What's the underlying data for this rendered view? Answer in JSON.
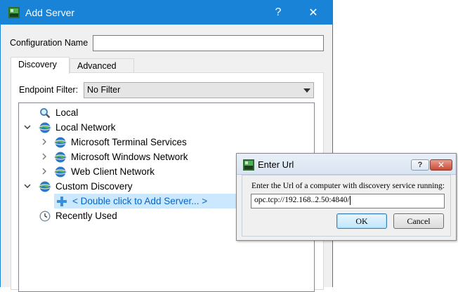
{
  "main_window": {
    "title": "Add Server",
    "help_label": "?",
    "close_label": "✕",
    "config_name_label": "Configuration Name",
    "config_name_value": "",
    "tabs": [
      {
        "label": "Discovery",
        "active": true
      },
      {
        "label": "Advanced",
        "active": false
      }
    ],
    "endpoint_filter_label": "Endpoint Filter:",
    "endpoint_filter_value": "No Filter",
    "tree": [
      {
        "label": "Local",
        "icon": "magnifier-icon",
        "expander": "none"
      },
      {
        "label": "Local Network",
        "icon": "network-globe-icon",
        "expander": "expanded"
      },
      {
        "label": "Microsoft Terminal Services",
        "icon": "network-globe-icon",
        "expander": "collapsed"
      },
      {
        "label": "Microsoft Windows Network",
        "icon": "network-globe-icon",
        "expander": "collapsed"
      },
      {
        "label": "Web Client Network",
        "icon": "network-globe-icon",
        "expander": "collapsed"
      },
      {
        "label": "Custom Discovery",
        "icon": "network-globe-icon",
        "expander": "expanded"
      },
      {
        "label": "< Double click to Add Server... >",
        "icon": "plus-icon",
        "expander": "none",
        "selected": true
      },
      {
        "label": "Recently Used",
        "icon": "clock-icon",
        "expander": "none"
      }
    ]
  },
  "dialog": {
    "title": "Enter Url",
    "help_label": "?",
    "close_label": "✕",
    "prompt": "Enter the Url of a computer with discovery service running:",
    "url_value": "opc.tcp://192.168..2.50:4840/",
    "ok_label": "OK",
    "cancel_label": "Cancel"
  },
  "colors": {
    "titlebar": "#1883d7",
    "selection": "#cce8ff",
    "selection_text": "#0066cc"
  }
}
